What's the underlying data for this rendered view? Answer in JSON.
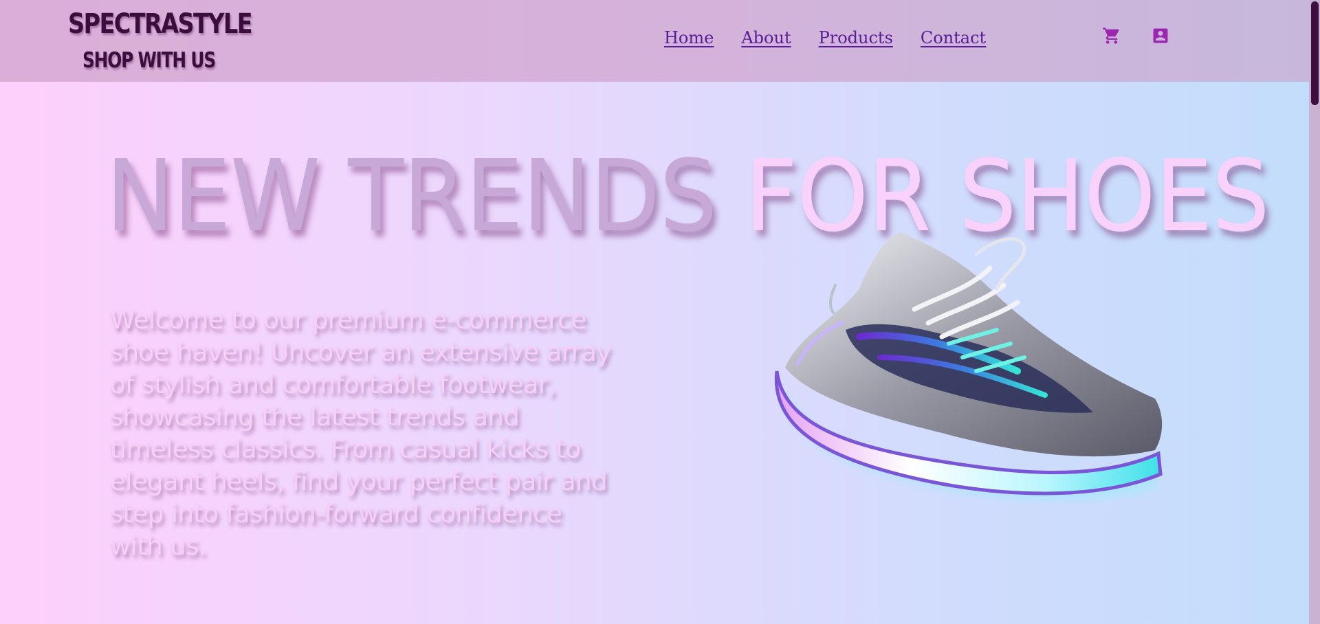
{
  "brand": {
    "title": "SPECTRASTYLE",
    "tagline": "SHOP WITH US"
  },
  "nav": {
    "items": [
      {
        "label": "Home"
      },
      {
        "label": "About"
      },
      {
        "label": "Products"
      },
      {
        "label": "Contact"
      }
    ]
  },
  "header_icons": {
    "cart": "shopping-cart-icon",
    "account": "account-box-icon"
  },
  "hero": {
    "title_part1": "NEW TRENDS",
    "title_part2": "FOR SHOES",
    "description": "Welcome to our premium e-commerce shoe haven! Uncover an extensive array of stylish and comfortable footwear, showcasing the latest trends and timeless classics. From casual kicks to elegant heels, find your perfect pair and step into fashion-forward confidence with us."
  },
  "colors": {
    "brand_dark": "#3a0d3d",
    "nav_link": "#5a1b9a",
    "icon_purple": "#9b27b0",
    "title_part1": "#c8a8d7",
    "title_part2": "#f9d2fb",
    "description_text": "#f6d0f6"
  }
}
